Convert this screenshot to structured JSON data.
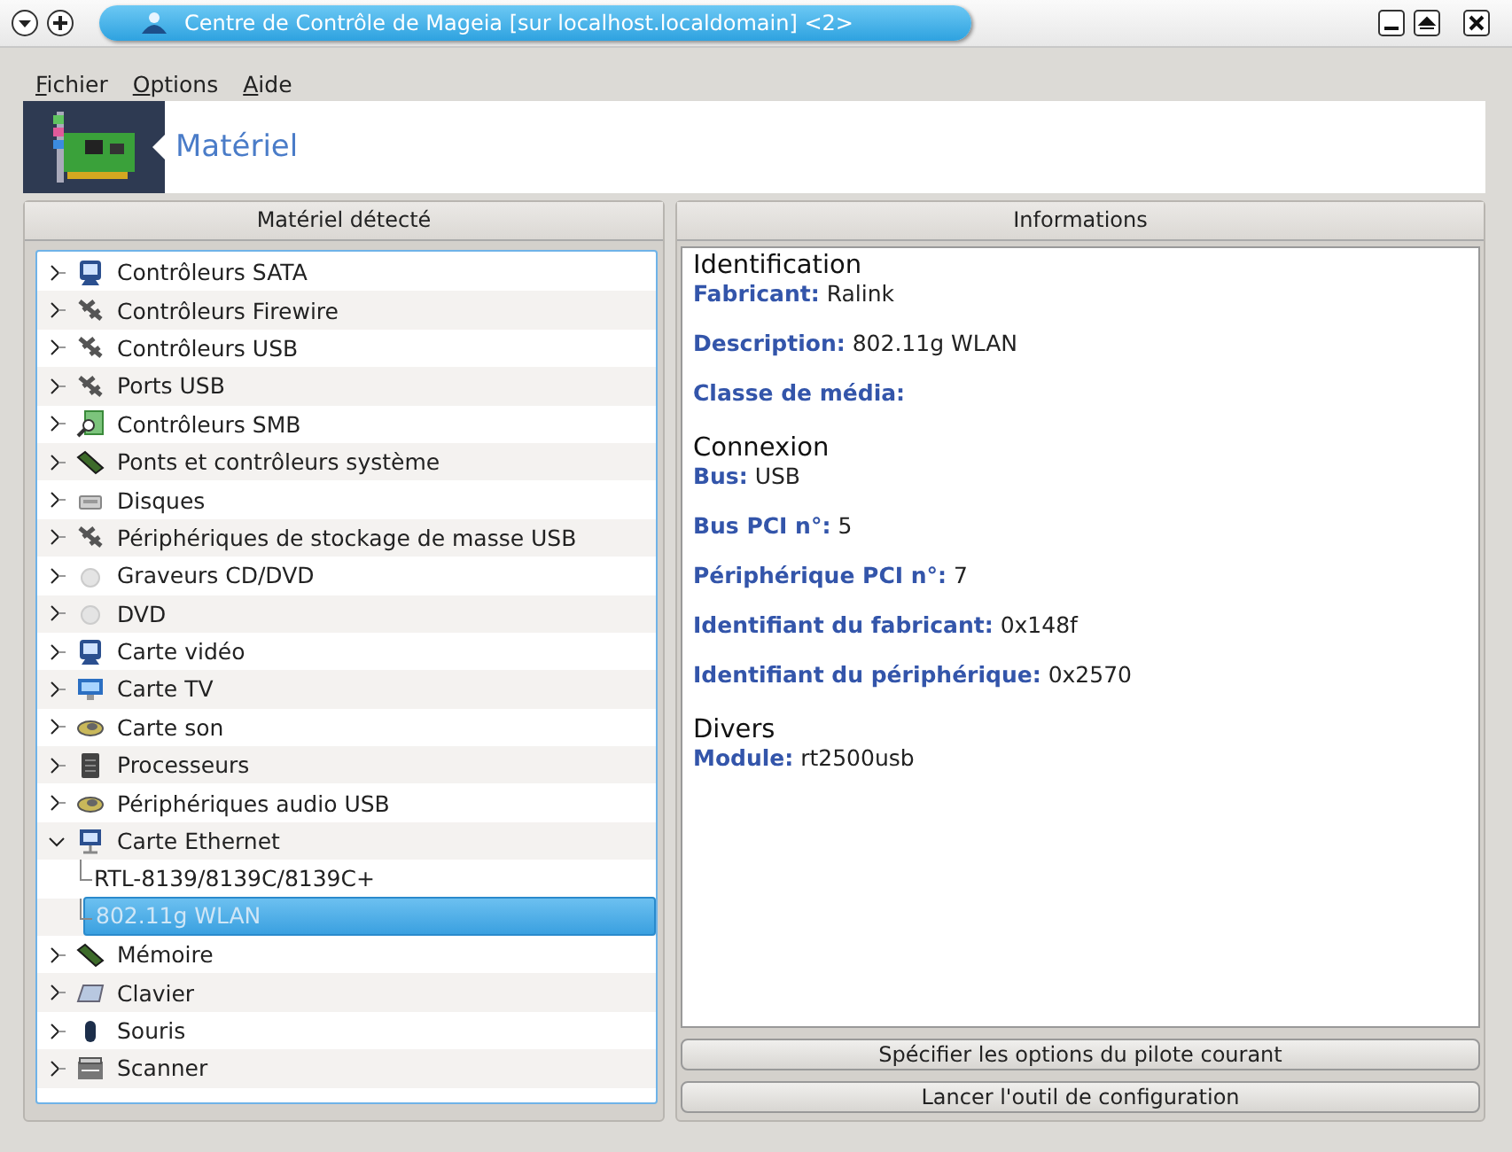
{
  "window": {
    "title": "Centre de Contrôle de Mageia  [sur localhost.localdomain] <2>"
  },
  "menu": [
    "Fichier",
    "Options",
    "Aide"
  ],
  "banner": {
    "title": "Matériel"
  },
  "tree_panel": {
    "header": "Matériel détecté",
    "items": [
      {
        "label": "Contrôleurs SATA",
        "kind": "sata",
        "expanded": false
      },
      {
        "label": "Contrôleurs Firewire",
        "kind": "usb",
        "expanded": false
      },
      {
        "label": "Contrôleurs USB",
        "kind": "usb",
        "expanded": false
      },
      {
        "label": "Ports USB",
        "kind": "usb",
        "expanded": false
      },
      {
        "label": "Contrôleurs SMB",
        "kind": "smb",
        "expanded": false
      },
      {
        "label": "Ponts et contrôleurs système",
        "kind": "ram",
        "expanded": false
      },
      {
        "label": "Disques",
        "kind": "disk",
        "expanded": false
      },
      {
        "label": "Périphériques de stockage de masse USB",
        "kind": "usb",
        "expanded": false
      },
      {
        "label": "Graveurs CD/DVD",
        "kind": "cd",
        "expanded": false
      },
      {
        "label": "DVD",
        "kind": "cd",
        "expanded": false
      },
      {
        "label": "Carte vidéo",
        "kind": "sata",
        "expanded": false
      },
      {
        "label": "Carte TV",
        "kind": "tv",
        "expanded": false
      },
      {
        "label": "Carte son",
        "kind": "sound",
        "expanded": false
      },
      {
        "label": "Processeurs",
        "kind": "cpu",
        "expanded": false
      },
      {
        "label": "Périphériques audio USB",
        "kind": "sound",
        "expanded": false
      },
      {
        "label": "Carte Ethernet",
        "kind": "ethernet",
        "expanded": true,
        "children": [
          {
            "label": "RTL-8139/8139C/8139C+",
            "selected": false
          },
          {
            "label": "802.11g WLAN",
            "selected": true
          }
        ]
      },
      {
        "label": "Mémoire",
        "kind": "ram",
        "expanded": false
      },
      {
        "label": "Clavier",
        "kind": "keyboard",
        "expanded": false
      },
      {
        "label": "Souris",
        "kind": "mouse",
        "expanded": false
      },
      {
        "label": "Scanner",
        "kind": "scanner",
        "expanded": false
      }
    ]
  },
  "info_panel": {
    "header": "Informations",
    "sections": [
      {
        "heading": "Identification",
        "fields": [
          {
            "label": "Fabricant:",
            "value": "Ralink"
          },
          {
            "label": "Description:",
            "value": "802.11g WLAN"
          },
          {
            "label": "Classe de média:"
          }
        ]
      },
      {
        "heading": "Connexion",
        "fields": [
          {
            "label": "Bus:",
            "value": "USB"
          },
          {
            "label": "Bus PCI n°:",
            "value": "5"
          },
          {
            "label": "Périphérique PCI n°:",
            "value": "7"
          },
          {
            "label": "Identifiant du fabricant:",
            "value": "0x148f"
          },
          {
            "label": "Identifiant du périphérique:",
            "value": "0x2570"
          }
        ]
      },
      {
        "heading": "Divers",
        "fields": [
          {
            "label": "Module:",
            "value": "rt2500usb"
          }
        ]
      }
    ],
    "buttons": [
      "Spécifier les options du pilote courant",
      "Lancer l'outil de configuration"
    ]
  }
}
